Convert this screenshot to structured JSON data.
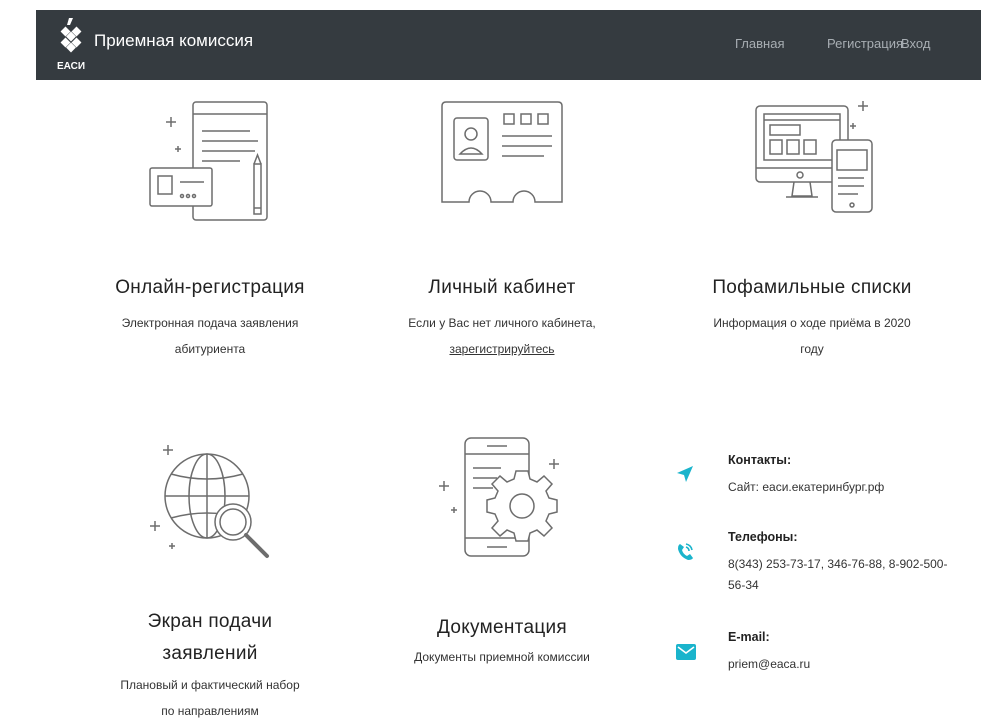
{
  "header": {
    "title": "Приемная комиссия",
    "logo_text": "ЕАСИ",
    "nav": [
      {
        "label": "Главная"
      },
      {
        "label": "Регистрация"
      },
      {
        "label": "Вход"
      }
    ]
  },
  "cards": [
    {
      "title": "Онлайн-регистрация",
      "description": "Электронная подача заявления абитуриента"
    },
    {
      "title": "Личный кабинет",
      "description": "Если у Вас нет личного кабинета,",
      "link": "зарегистрируйтесь"
    },
    {
      "title": "Пофамильные списки",
      "description": "Информация о ходе приёма в 2020 году"
    },
    {
      "title": "Экран подачи заявлений",
      "description": "Плановый и фактический набор по направлениям"
    },
    {
      "title": "Документация",
      "description": "Документы приемной комиссии"
    }
  ],
  "contacts": [
    {
      "icon": "location-arrow-icon",
      "title": "Контакты:",
      "text": "Сайт: еаси.екатеринбург.рф"
    },
    {
      "icon": "phone-icon",
      "title": "Телефоны:",
      "text": "8(343) 253-73-17, 346-76-88, 8-902-500-56-34"
    },
    {
      "icon": "envelope-icon",
      "title": "E-mail:",
      "text": "priem@eaca.ru"
    }
  ],
  "colors": {
    "navbar": "#353b40",
    "accent": "#1ab4cc",
    "icon_stroke": "#6d6d6d"
  }
}
